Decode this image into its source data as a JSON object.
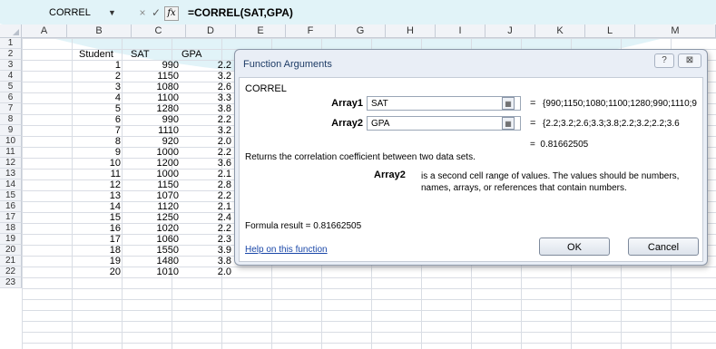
{
  "formula_bar": {
    "name_box": "CORREL",
    "cancel_icon": "×",
    "enter_icon": "✓",
    "fx_label": "fx",
    "formula": "=CORREL(SAT,GPA)"
  },
  "columns": [
    "A",
    "B",
    "C",
    "D",
    "E",
    "F",
    "G",
    "H",
    "I",
    "J",
    "K",
    "L",
    "M"
  ],
  "rows": [
    "1",
    "2",
    "3",
    "4",
    "5",
    "6",
    "7",
    "8",
    "9",
    "10",
    "11",
    "12",
    "13",
    "14",
    "15",
    "16",
    "17",
    "18",
    "19",
    "20",
    "21",
    "22",
    "23"
  ],
  "headers": {
    "student": "Student",
    "sat": "SAT",
    "gpa": "GPA"
  },
  "table": [
    [
      "1",
      "990",
      "2.2"
    ],
    [
      "2",
      "1150",
      "3.2"
    ],
    [
      "3",
      "1080",
      "2.6"
    ],
    [
      "4",
      "1100",
      "3.3"
    ],
    [
      "5",
      "1280",
      "3.8"
    ],
    [
      "6",
      "990",
      "2.2"
    ],
    [
      "7",
      "1110",
      "3.2"
    ],
    [
      "8",
      "920",
      "2.0"
    ],
    [
      "9",
      "1000",
      "2.2"
    ],
    [
      "10",
      "1200",
      "3.6"
    ],
    [
      "11",
      "1000",
      "2.1"
    ],
    [
      "12",
      "1150",
      "2.8"
    ],
    [
      "13",
      "1070",
      "2.2"
    ],
    [
      "14",
      "1120",
      "2.1"
    ],
    [
      "15",
      "1250",
      "2.4"
    ],
    [
      "16",
      "1020",
      "2.2"
    ],
    [
      "17",
      "1060",
      "2.3"
    ],
    [
      "18",
      "1550",
      "3.9"
    ],
    [
      "19",
      "1480",
      "3.8"
    ],
    [
      "20",
      "1010",
      "2.0"
    ]
  ],
  "dialog": {
    "title": "Function Arguments",
    "help_icon": "?",
    "close_icon": "⊠",
    "function_name": "CORREL",
    "array1_label": "Array1",
    "array1_value": "SAT",
    "array1_result": "{990;1150;1080;1100;1280;990;1110;9",
    "array2_label": "Array2",
    "array2_value": "GPA",
    "array2_result": "{2.2;3.2;2.6;3.3;3.8;2.2;3.2;2.2;3.6",
    "equals": "=",
    "result_value": "0.81662505",
    "description": "Returns the correlation coefficient between two data sets.",
    "arg_desc_label": "Array2",
    "arg_desc_text": "is a second cell range of values. The values should be numbers, names, arrays, or references that contain numbers.",
    "formula_result": "Formula result =  0.81662505",
    "help_link": "Help on this function",
    "ok_label": "OK",
    "cancel_label": "Cancel"
  },
  "colors": {
    "accent": "#1e3c66",
    "link": "#1a47a8",
    "watermark": "#a9ddec"
  }
}
